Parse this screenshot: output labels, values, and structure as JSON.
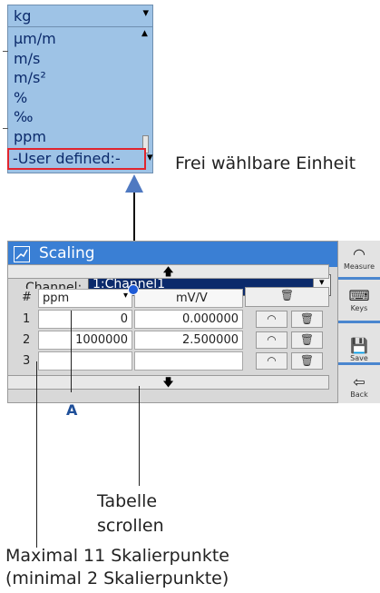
{
  "dropdown": {
    "selected": "kg",
    "items": [
      "µm/m",
      "m/s",
      "m/s²",
      "%",
      "‰",
      "ppm"
    ],
    "highlighted": "-User defined:-",
    "arrow": "▾"
  },
  "unit_caption": "Frei wählbare Einheit",
  "window": {
    "title": "Scaling",
    "channel_label": "Channel:",
    "channel_value": "1:Channel1",
    "up_arrow": "🡅",
    "down_arrow": "🡇",
    "table": {
      "header_index": "#",
      "header_unit_a": "ppm",
      "header_unit_b": "mV/V",
      "rows": [
        {
          "index": "1",
          "a": "0",
          "b": "0.000000"
        },
        {
          "index": "2",
          "a": "1000000",
          "b": "2.500000"
        },
        {
          "index": "3",
          "a": "",
          "b": ""
        }
      ]
    }
  },
  "toolbar": {
    "measure_label": "Measure",
    "keys_label": "Keys",
    "save_label": "Save",
    "back_label": "Back"
  },
  "annotations": {
    "marker_a": "A",
    "scroll_line1": "Tabelle",
    "scroll_line2": "scrollen",
    "points_line1": "Maximal 11 Skalierpunkte",
    "points_line2": "(minimal 2 Skalierpunkte)"
  }
}
